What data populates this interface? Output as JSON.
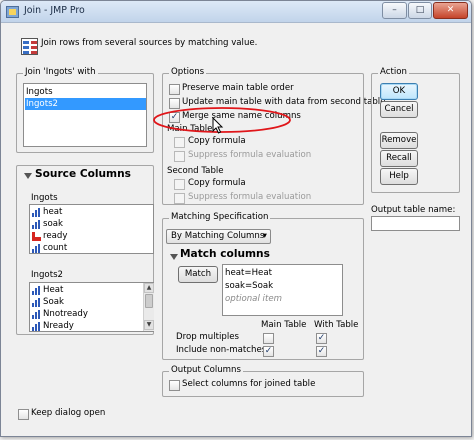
{
  "window": {
    "title": "Join - JMP Pro",
    "minimize": "–",
    "maximize": "□",
    "close": "✕"
  },
  "header": {
    "description": "Join rows from several sources by matching value."
  },
  "join_with": {
    "label": "Join 'Ingots' with",
    "items": [
      "Ingots",
      "Ingots2"
    ],
    "selected": "Ingots2"
  },
  "source_columns": {
    "title": "Source Columns",
    "table1": {
      "name": "Ingots",
      "columns": [
        "heat",
        "soak",
        "ready",
        "count"
      ]
    },
    "table2": {
      "name": "Ingots2",
      "columns": [
        "Heat",
        "Soak",
        "Nnotready",
        "Nready"
      ]
    }
  },
  "options": {
    "label": "Options",
    "preserve_main": "Preserve main table order",
    "update_main": "Update main table with data from second table",
    "merge_same": "Merge same name columns",
    "main_table_label": "Main Table",
    "second_table_label": "Second Table",
    "copy_formula": "Copy formula",
    "suppress_formula": "Suppress formula evaluation"
  },
  "action": {
    "label": "Action",
    "ok": "OK",
    "cancel": "Cancel",
    "remove": "Remove",
    "recall": "Recall",
    "help": "Help"
  },
  "output_table": {
    "label": "Output table name:",
    "value": ""
  },
  "matching": {
    "label": "Matching Specification",
    "method": "By Matching Columns",
    "match_columns_title": "Match columns",
    "match_button": "Match",
    "pairs": [
      "heat=Heat",
      "soak=Soak"
    ],
    "optional_item": "optional item",
    "main_table_header": "Main Table",
    "with_table_header": "With Table",
    "drop_multiples": "Drop multiples",
    "include_non_matches": "Include non-matches"
  },
  "output_columns": {
    "label": "Output Columns",
    "select_columns": "Select columns for joined table"
  },
  "footer": {
    "keep_dialog_open": "Keep dialog open"
  },
  "glyphs": {
    "check": "✓",
    "dropdown_arrow": "▾",
    "scroll_up": "▲",
    "scroll_down": "▼"
  },
  "colors": {
    "selection": "#3399ff",
    "annotation_ellipse": "#e0161a",
    "title_bar": "#c8d9ee"
  }
}
